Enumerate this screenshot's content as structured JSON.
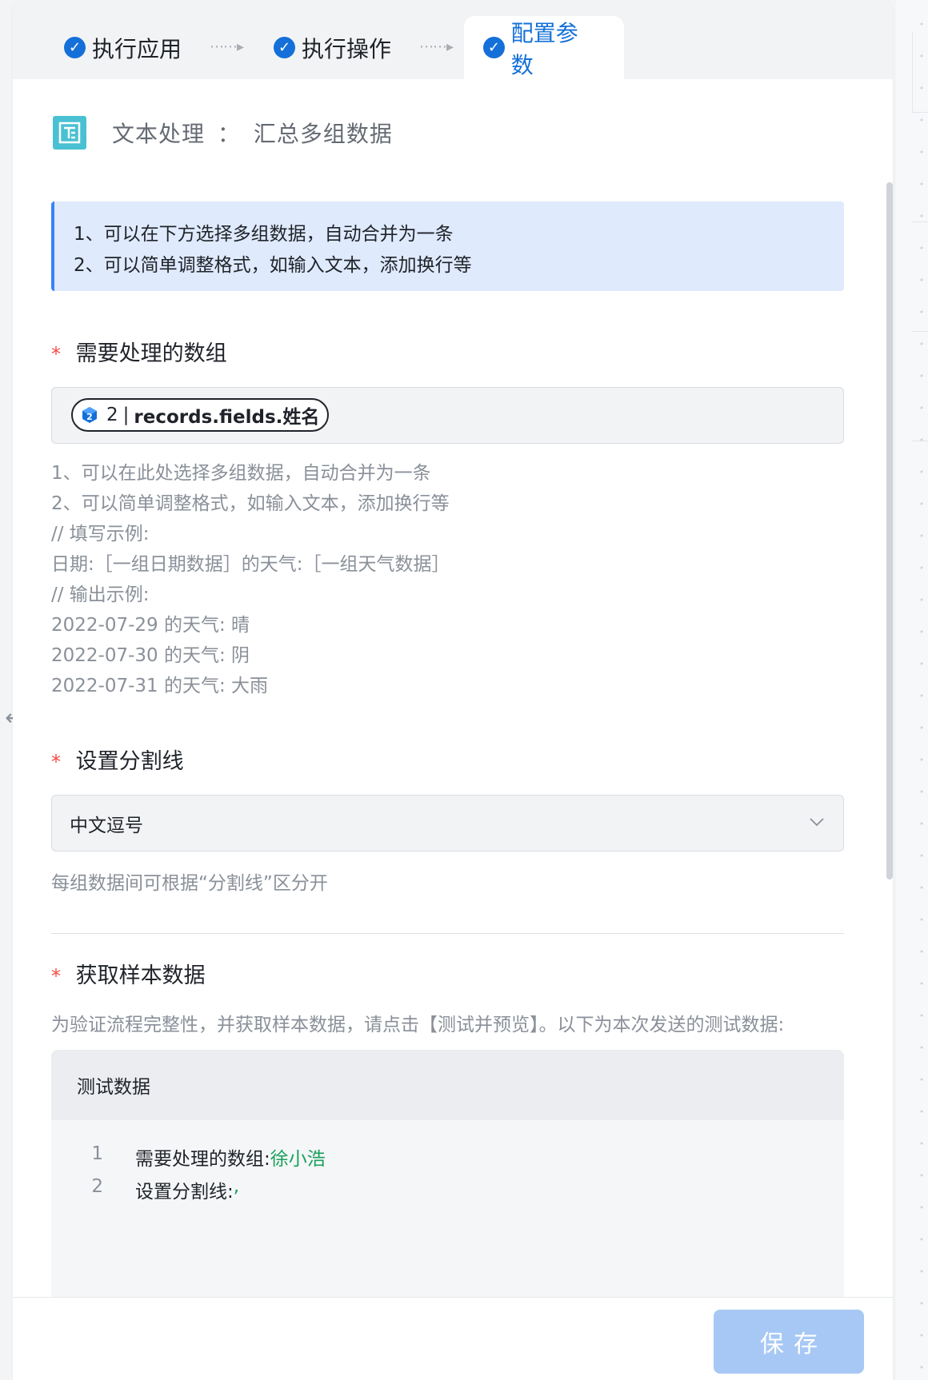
{
  "steps": [
    {
      "label": "执行应用"
    },
    {
      "label": "执行操作"
    },
    {
      "label": "配置参数"
    }
  ],
  "app": {
    "name": "文本处理",
    "separator": "：",
    "action": "汇总多组数据"
  },
  "notice": {
    "lines": [
      "1、可以在下方选择多组数据，自动合并为一条",
      "2、可以简单调整格式，如输入文本，添加换行等"
    ]
  },
  "fields": {
    "array": {
      "required_mark": "*",
      "label": "需要处理的数组",
      "token": {
        "step": "2",
        "divider": "|",
        "path": "records.fields.姓名"
      },
      "help": [
        "1、可以在此处选择多组数据，自动合并为一条",
        "2、可以简单调整格式，如输入文本，添加换行等",
        "// 填写示例:",
        "日期:［一组日期数据］的天气:［一组天气数据］",
        "// 输出示例:",
        "2022-07-29 的天气: 晴",
        "2022-07-30 的天气: 阴",
        "2022-07-31 的天气: 大雨"
      ]
    },
    "separator": {
      "required_mark": "*",
      "label": "设置分割线",
      "selected": "中文逗号",
      "hint": "每组数据间可根据“分割线”区分开"
    },
    "sample": {
      "required_mark": "*",
      "label": "获取样本数据",
      "description": "为验证流程完整性，并获取样本数据，请点击【测试并预览】。以下为本次发送的测试数据:",
      "box_title": "测试数据",
      "lines": [
        {
          "no": "1",
          "key": "需要处理的数组: ",
          "value": "徐小浩"
        },
        {
          "no": "2",
          "key": "设置分割线: ",
          "value": ","
        }
      ]
    }
  },
  "footer": {
    "save_label": "保存"
  },
  "colors": {
    "accent": "#1470d8",
    "required": "#f54a45",
    "value_green": "#19a05b",
    "save_disabled": "#a7c8f4"
  }
}
